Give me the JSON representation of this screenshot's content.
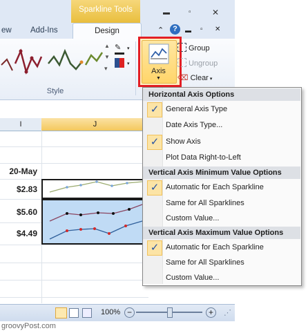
{
  "ribbon": {
    "context_tab": "Sparkline Tools",
    "tabs": [
      "ew",
      "Add-Ins",
      "Design"
    ],
    "style_group_label": "Style",
    "axis_label": "Axis",
    "group_label": "Group",
    "ungroup_label": "Ungroup",
    "clear_label": "Clear"
  },
  "sheet": {
    "col_i": "I",
    "col_j": "J",
    "date_header": "20-May",
    "values": [
      "$2.83",
      "$5.60",
      "$4.49"
    ]
  },
  "status": {
    "zoom": "100%"
  },
  "menu": {
    "h1": "Horizontal Axis Options",
    "general": "General Axis Type",
    "date": "Date Axis Type...",
    "show": "Show Axis",
    "rtl": "Plot Data Right-to-Left",
    "h2": "Vertical Axis Minimum Value Options",
    "min_auto": "Automatic for Each Sparkline",
    "min_same": "Same for All Sparklines",
    "min_custom": "Custom Value...",
    "h3": "Vertical Axis Maximum Value Options",
    "max_auto": "Automatic for Each Sparkline",
    "max_same": "Same for All Sparklines",
    "max_custom": "Custom Value..."
  },
  "watermark": "groovyPost.com",
  "colors": {
    "highlight_red": "#e31e24",
    "context_gold": "#e9be3d",
    "selection_blue": "#c0dbf5"
  }
}
